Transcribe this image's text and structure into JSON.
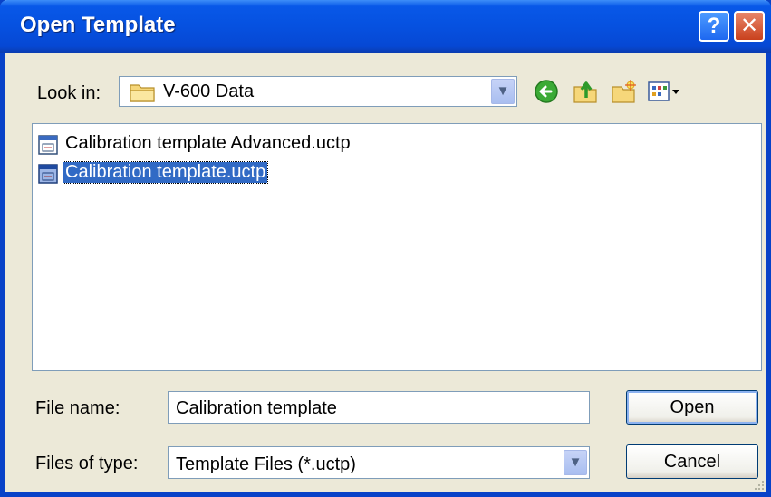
{
  "window": {
    "title": "Open Template"
  },
  "title_buttons": {
    "help": "?",
    "close": "✕"
  },
  "look_in": {
    "label": "Look in:",
    "value": "V-600 Data"
  },
  "toolbar": {
    "back_icon": "back-arrow-icon",
    "up_icon": "up-folder-icon",
    "new_folder_icon": "new-folder-icon",
    "views_icon": "views-menu-icon"
  },
  "files": [
    {
      "name": "Calibration template Advanced.uctp",
      "selected": false
    },
    {
      "name": "Calibration template.uctp",
      "selected": true
    }
  ],
  "file_name": {
    "label": "File name:",
    "value": "Calibration template"
  },
  "file_type": {
    "label": "Files of type:",
    "value": "Template Files (*.uctp)"
  },
  "buttons": {
    "open": "Open",
    "cancel": "Cancel"
  },
  "colors": {
    "titlebar": "#0651E0",
    "selection": "#316AC5",
    "dialog_bg": "#ECE9D8"
  }
}
